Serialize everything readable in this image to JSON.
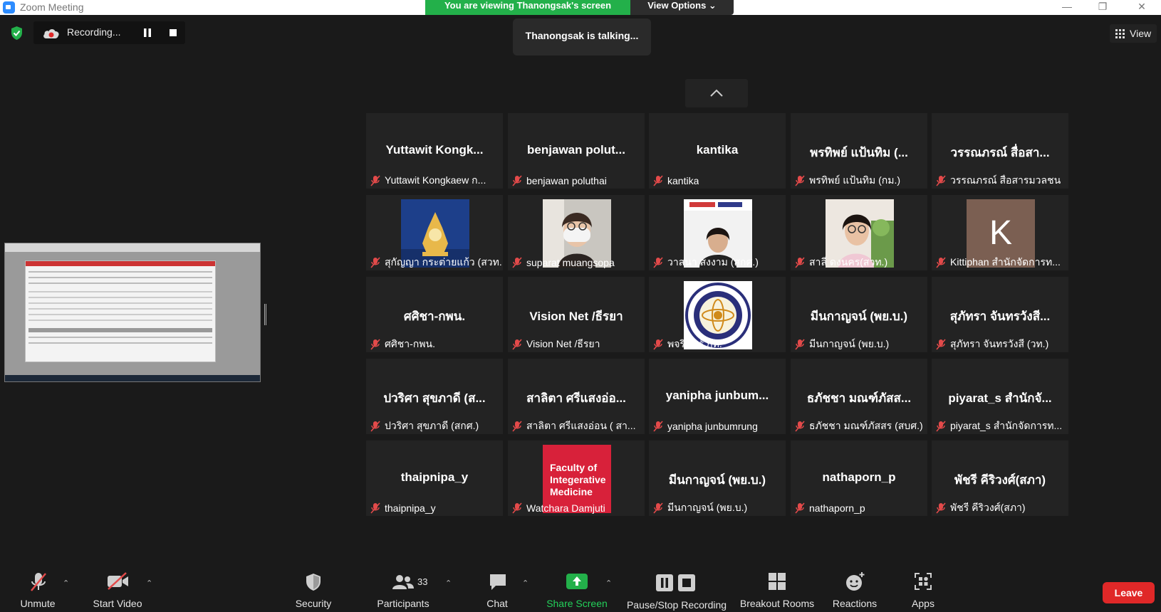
{
  "window": {
    "title": "Zoom Meeting",
    "minimize": "—",
    "restore": "❐",
    "close": "✕"
  },
  "banner": {
    "viewing_text": "You are viewing Thanongsak's screen",
    "view_options": "View Options ⌄"
  },
  "recording": {
    "label": "Recording..."
  },
  "talking": "Thanongsak is talking...",
  "view_button": "View",
  "tiles": [
    {
      "big": "Yuttawit Kongk...",
      "name": "Yuttawit Kongkaew ก..."
    },
    {
      "big": "benjawan polut...",
      "name": "benjawan poluthai"
    },
    {
      "big": "kantika",
      "name": "kantika"
    },
    {
      "big": "พรทิพย์ แป้นทิม (...",
      "name": "พรทิพย์ แป้นทิม (กม.)"
    },
    {
      "big": "วรรณภรณ์ สื่อสา...",
      "name": "วรรณภรณ์ สื่อสารมวลชน"
    },
    {
      "big": "",
      "name": "สุกัญญา กระต่ายแก้ว (สวท.)",
      "media": "logo-blue"
    },
    {
      "big": "",
      "name": "suparat muangsopa",
      "media": "face-mask"
    },
    {
      "big": "",
      "name": "วาสนา สงงาม (สกศ.)",
      "media": "face-banner"
    },
    {
      "big": "",
      "name": "สาลี่ ดงนคร(สวท.)",
      "media": "face-plant"
    },
    {
      "big": "",
      "name": "Kittiphan สำนักจัดการท...",
      "media": "letter",
      "letter": "K"
    },
    {
      "big": "ศศิชา-กพน.",
      "name": "ศศิชา-กพน."
    },
    {
      "big": "Vision Net /ธีรยา",
      "name": "Vision Net /ธีรยา"
    },
    {
      "big": "",
      "name": "พจรินทร์ กท.",
      "media": "seal"
    },
    {
      "big": "มีนกาญจน์ (พย.บ.)",
      "name": "มีนกาญจน์ (พย.บ.)"
    },
    {
      "big": "สุภัทรา จันทรวังสี...",
      "name": "สุภัทรา จันทรวังสี (วท.)"
    },
    {
      "big": "ปวริศา สุขภาดี (ส...",
      "name": "ปวริศา สุขภาดี (สกศ.)"
    },
    {
      "big": "สาลิตา ศรีแสงอ่อ...",
      "name": "สาลิตา ศรีแสงอ่อน ( สา..."
    },
    {
      "big": "yanipha junbum...",
      "name": "yanipha junbumrung"
    },
    {
      "big": "ธภัชชา มณฑ์ภัสส...",
      "name": "ธภัชชา มณฑ์ภัสสร (สบศ.)"
    },
    {
      "big": "piyarat_s สำนักจั...",
      "name": "piyarat_s สำนักจัดการท..."
    },
    {
      "big": "thaipnipa_y",
      "name": "thaipnipa_y"
    },
    {
      "big": "",
      "name": "Watchara Damjuti",
      "media": "faculty",
      "faculty_text": [
        "Faculty of",
        "Integerative",
        "Medicine"
      ]
    },
    {
      "big": "มีนกาญจน์ (พย.บ.)",
      "name": "มีนกาญจน์ (พย.บ.)"
    },
    {
      "big": "nathaporn_p",
      "name": "nathaporn_p"
    },
    {
      "big": "พัชรี คีริวงศ์(สภา)",
      "name": "พัชรี คีริวงศ์(สภา)"
    }
  ],
  "toolbar": {
    "unmute": "Unmute",
    "start_video": "Start Video",
    "security": "Security",
    "participants": "Participants",
    "participants_count": "33",
    "chat": "Chat",
    "share_screen": "Share Screen",
    "pause_stop": "Pause/Stop Recording",
    "breakout": "Breakout Rooms",
    "reactions": "Reactions",
    "apps": "Apps",
    "leave": "Leave"
  },
  "colors": {
    "green": "#23b04a",
    "leave": "#e02828",
    "tile_bg": "#232323",
    "mic_red": "#e34a4a"
  }
}
